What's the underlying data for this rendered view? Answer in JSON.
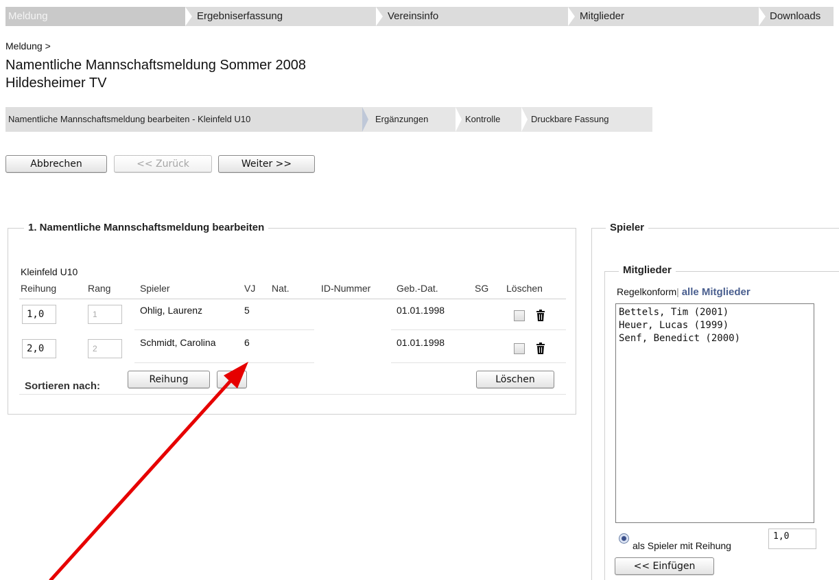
{
  "topnav": {
    "tabs": [
      {
        "label": "Meldung"
      },
      {
        "label": "Ergebniserfassung"
      },
      {
        "label": "Vereinsinfo"
      },
      {
        "label": "Mitglieder"
      },
      {
        "label": "Downloads"
      }
    ]
  },
  "breadcrumb": "Meldung >",
  "page": {
    "title": "Namentliche Mannschaftsmeldung Sommer 2008",
    "subtitle": "Hildesheimer TV"
  },
  "steps": [
    {
      "label": "Namentliche Mannschaftsmeldung bearbeiten - Kleinfeld U10"
    },
    {
      "label": "Ergänzungen"
    },
    {
      "label": "Kontrolle"
    },
    {
      "label": "Druckbare Fassung"
    }
  ],
  "actions": {
    "cancel": "Abbrechen",
    "back": "<< Zurück",
    "next": "Weiter >>"
  },
  "main_panel": {
    "legend": "1. Namentliche Mannschaftsmeldung bearbeiten",
    "team": "Kleinfeld U10",
    "columns": [
      "Reihung",
      "Rang",
      "Spieler",
      "VJ",
      "Nat.",
      "ID-Nummer",
      "Geb.-Dat.",
      "SG",
      "Löschen"
    ],
    "rows": [
      {
        "reihung": "1,0",
        "rang": "1",
        "spieler": "Ohlig, Laurenz",
        "vj": "5",
        "nat": "",
        "id": "",
        "geb": "01.01.1998",
        "sg": ""
      },
      {
        "reihung": "2,0",
        "rang": "2",
        "spieler": "Schmidt, Carolina",
        "vj": "6",
        "nat": "",
        "id": "",
        "geb": "01.01.1998",
        "sg": ""
      }
    ],
    "sort_label": "Sortieren nach:",
    "sort_reihung": "Reihung",
    "sort_vj": "VJ",
    "delete_button": "Löschen"
  },
  "side_panel": {
    "legend": "Spieler",
    "members_legend": "Mitglieder",
    "filter_current": "Regelkonform",
    "filter_sep": "|",
    "filter_all": "alle Mitglieder",
    "list": [
      "Bettels, Tim (2001)",
      "Heuer, Lucas (1999)",
      "Senf, Benedict (2000)"
    ],
    "radio_label": "als Spieler mit Reihung",
    "reihung_value": "1,0",
    "insert_button": "<< Einfügen"
  },
  "colors": {
    "annotation_arrow": "#e60000",
    "link": "#4a5f8f"
  }
}
